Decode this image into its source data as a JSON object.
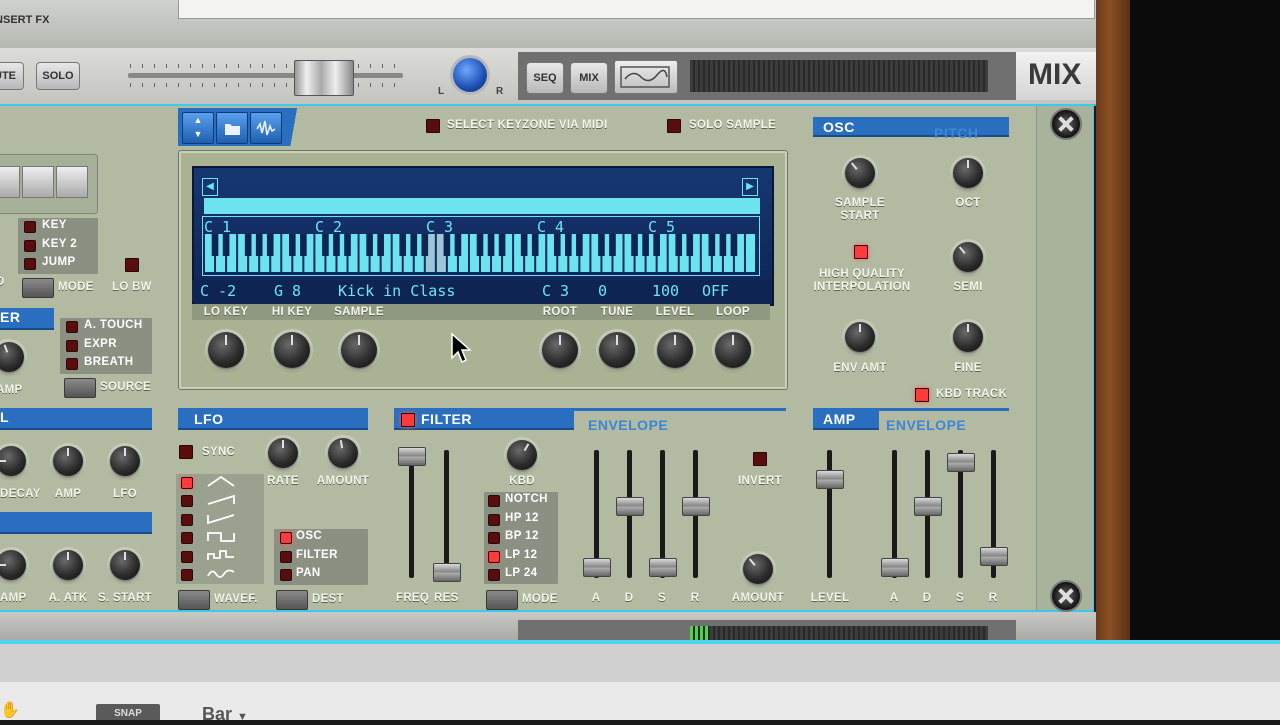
{
  "top": {
    "insert_fx": "INSERT FX"
  },
  "mixer": {
    "mute": "UTE",
    "solo": "SOLO",
    "pan_l": "L",
    "pan_r": "R",
    "seq": "SEQ",
    "mix": "MIX",
    "logo": "MIX"
  },
  "sampler": {
    "select_keyzone": "SELECT KEYZONE VIA MIDI",
    "solo_sample": "SOLO SAMPLE",
    "keyboard_octaves": [
      "C 1",
      "C 2",
      "C 3",
      "C 4",
      "C 5"
    ],
    "display": {
      "lo_key": "C -2",
      "hi_key": "G 8",
      "sample": "Kick in Class",
      "root": "C 3",
      "tune": "0",
      "level": "100",
      "loop": "OFF"
    },
    "knob_labels": [
      "LO KEY",
      "HI KEY",
      "SAMPLE",
      "ROOT",
      "TUNE",
      "LEVEL",
      "LOOP"
    ]
  },
  "left": {
    "key_modes": [
      "KEY",
      "KEY 2",
      "JUMP"
    ],
    "mode_label": "MODE",
    "lo_bw": "LO BW",
    "mod_section": "ER",
    "sources": [
      "A. TOUCH",
      "EXPR",
      "BREATH"
    ],
    "source_label": "SOURCE",
    "amp_label": "AMP",
    "d_label": "D",
    "section_l": "L",
    "row1": [
      "DECAY",
      "AMP",
      "LFO"
    ],
    "row2": [
      "AMP",
      "A. ATK",
      "S. START"
    ]
  },
  "lfo": {
    "title": "LFO",
    "sync": "SYNC",
    "rate": "RATE",
    "amount": "AMOUNT",
    "waveform_label": "WAVEF.",
    "dest": [
      "OSC",
      "FILTER",
      "PAN"
    ],
    "dest_label": "DEST"
  },
  "filter": {
    "title": "FILTER",
    "envelope": "ENVELOPE",
    "freq": "FREQ",
    "res": "RES",
    "kbd": "KBD",
    "modes": [
      "NOTCH",
      "HP 12",
      "BP 12",
      "LP 12",
      "LP 24"
    ],
    "mode_label": "MODE",
    "env_labels": [
      "A",
      "D",
      "S",
      "R"
    ],
    "invert": "INVERT",
    "amount": "AMOUNT",
    "env_levels": [
      0.0,
      0.55,
      0.0,
      0.55
    ]
  },
  "osc": {
    "title": "OSC",
    "pitch": "PITCH",
    "sample_start": "SAMPLE START",
    "oct": "OCT",
    "hq_interp": "HIGH QUALITY INTERPOLATION",
    "semi": "SEMI",
    "env_amt": "ENV AMT",
    "fine": "FINE",
    "kbd_track": "KBD TRACK"
  },
  "amp": {
    "title": "AMP",
    "envelope": "ENVELOPE",
    "level": "LEVEL",
    "env_labels": [
      "A",
      "D",
      "S",
      "R"
    ],
    "env_levels": [
      0.0,
      0.55,
      0.95,
      0.1
    ]
  },
  "bottom": {
    "snap": "SNAP",
    "bar": "Bar"
  }
}
